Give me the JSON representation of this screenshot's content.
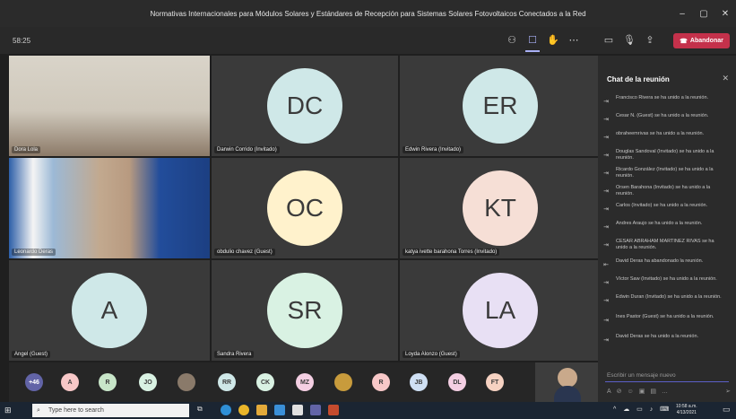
{
  "window": {
    "title": "Normativas Internacionales para Módulos Solares y Estándares de Recepción para Sistemas Solares Fotovoltaicos Conectados a la Red"
  },
  "toolbar": {
    "timer": "58:25",
    "leave_label": "Abandonar"
  },
  "participants": [
    {
      "name": "Dora Lola",
      "initials": "",
      "kind": "video"
    },
    {
      "name": "Darwin Corrido (Invitado)",
      "initials": "DC",
      "color": "#cfe8e8"
    },
    {
      "name": "Edwin Rivera (Invitado)",
      "initials": "ER",
      "color": "#cfe8e8"
    },
    {
      "name": "Leonardo Deras",
      "initials": "",
      "kind": "video"
    },
    {
      "name": "obdulio chavez (Guest)",
      "initials": "OC",
      "color": "#fff2cc"
    },
    {
      "name": "katya ivette barahona Torres (Invitado)",
      "initials": "KT",
      "color": "#f6dfd6"
    },
    {
      "name": "Angel (Guest)",
      "initials": "A",
      "color": "#cfe8e8"
    },
    {
      "name": "Sandra Rivera",
      "initials": "SR",
      "color": "#d9f2e3"
    },
    {
      "name": "Loyda Alonzo (Guest)",
      "initials": "LA",
      "color": "#e8e0f4"
    }
  ],
  "strip": [
    {
      "label": "+46",
      "color": "#6264a7"
    },
    {
      "label": "A",
      "color": "#f8c8c8"
    },
    {
      "label": "R",
      "color": "#c8e6c9"
    },
    {
      "label": "JO",
      "color": "#d9f2e3"
    },
    {
      "label": "",
      "color": "#8a7a6a"
    },
    {
      "label": "RR",
      "color": "#cfe8e8"
    },
    {
      "label": "CK",
      "color": "#d9f2e3"
    },
    {
      "label": "MZ",
      "color": "#f4cfe3"
    },
    {
      "label": "",
      "color": "#c89b3c"
    },
    {
      "label": "R",
      "color": "#f8c8c8"
    },
    {
      "label": "JB",
      "color": "#cfe0f4"
    },
    {
      "label": "DL",
      "color": "#f4cfe3"
    },
    {
      "label": "FT",
      "color": "#f6d2c2"
    }
  ],
  "chat": {
    "title": "Chat de la reunión",
    "messages": [
      "Francisco Rivera se ha unido a la reunión.",
      "Cesar N. (Guest) se ha unido a la reunión.",
      "obraheemrivas se ha unido a la reunión.",
      "Douglas Sandoval (Invitado) se ha unido a la reunión.",
      "Ricardo González (Invitado) se ha unido a la reunión.",
      "Orsen Barahona (Invitado) se ha unido a la reunión.",
      "Carlos (Invitado) se ha unido a la reunión.",
      "Andres Araujo se ha unido a la reunión.",
      "CESAR ABRAHAM MARTINEZ RIVAS se ha unido a la reunión.",
      "David Deras ha abandonado la reunión.",
      "Víctor Saw (Invitado) se ha unido a la reunión.",
      "Edwin Duran (Invitado) se ha unido a la reunión.",
      "Ines Pastor (Guest) se ha unido a la reunión.",
      "David Deras se ha unido a la reunión."
    ],
    "composer_placeholder": "Escribir un mensaje nuevo"
  },
  "taskbar": {
    "search_placeholder": "Type here to search",
    "time": "10:58 a.m.",
    "date": "4/13/2021"
  }
}
